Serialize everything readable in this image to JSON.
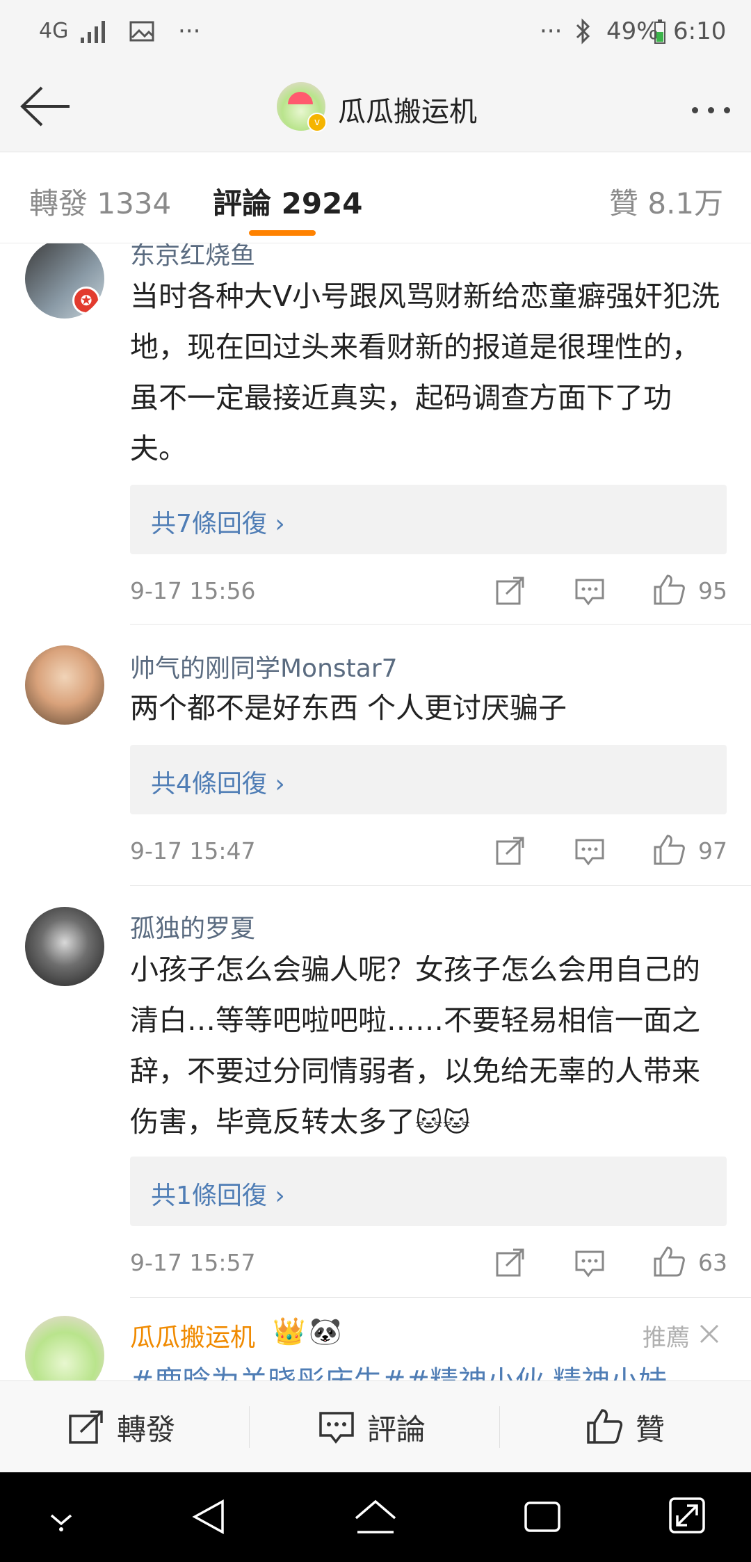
{
  "status_bar": {
    "network": "4G",
    "battery": "49%",
    "time": "6:10"
  },
  "header": {
    "title": "瓜瓜搬运机"
  },
  "tabs": [
    {
      "label": "轉發 1334"
    },
    {
      "label": "評論 2924"
    },
    {
      "label": "贊 8.1万"
    }
  ],
  "comments": [
    {
      "user": "东京红烧鱼",
      "text": "当时各种大V小号跟风骂财新给恋童癖强奸犯洗地，现在回过头来看财新的报道是很理性的，虽不一定最接近真实，起码调查方面下了功夫。",
      "replies": "共7條回復 ›",
      "time": "9-17 15:56",
      "likes": "95"
    },
    {
      "user": "帅气的刚同学Monstar7",
      "text": "两个都不是好东西 个人更讨厌骗子",
      "replies": "共4條回復 ›",
      "time": "9-17 15:47",
      "likes": "97"
    },
    {
      "user": "孤独的罗夏",
      "text": "小孩子怎么会骗人呢？女孩子怎么会用自己的清白…等等吧啦吧啦……不要轻易相信一面之辞，不要过分同情弱者，以免给无辜的人带来伤害，毕竟反转太多了",
      "replies": "共1條回復 ›",
      "time": "9-17 15:57",
      "likes": "63"
    }
  ],
  "recommended": {
    "user": "瓜瓜搬运机",
    "tag": "推薦",
    "text": "#鹿晗为关晓彤庆生##精神小伙 精神小妹"
  },
  "action_bar": {
    "repost": "轉發",
    "comment": "評論",
    "like": "贊"
  },
  "colors": {
    "accent": "#ff8200",
    "link": "#4f7db5",
    "username": "#5a6b80",
    "vip_name": "#f08a00"
  }
}
